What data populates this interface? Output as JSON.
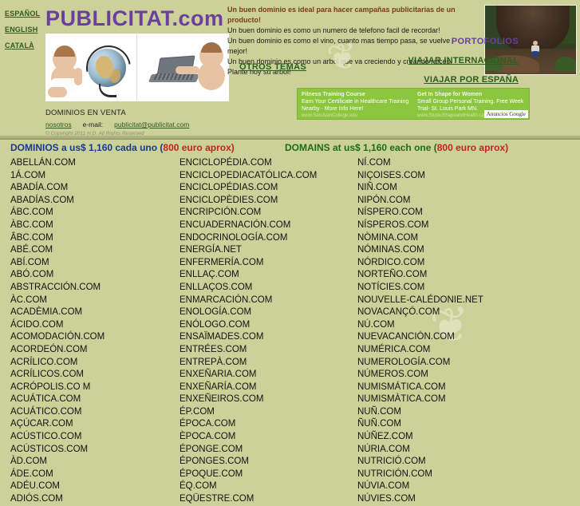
{
  "brand": "PUBLICITAT.com",
  "languages": [
    {
      "label": "ESPAÑOL"
    },
    {
      "label": "ENGLISH"
    },
    {
      "label": "CATALÀ"
    }
  ],
  "tagline": {
    "line1": "Un buen dominio es ideal para hacer campañas publicitarias de un producto!",
    "line2": "Un buen dominio es como un numero de telefono facil de recordar!",
    "line3": "Un buen dominio es como el vino, cuanto mas tiempo pasa, se vuelve mejor!",
    "line4": "Un buen dominio es como un arbol que va creciendo y creando raices. Plante hoy su arbol!"
  },
  "portfolio": {
    "title": "PORTOFOLIOS",
    "links": [
      {
        "label": "VIAJAR INTERNACIONAL"
      },
      {
        "label": "VIAJAR POR ESPAÑA"
      }
    ],
    "otros": "OTROS TEMAS"
  },
  "contact": {
    "heading": "DOMINIOS EN VENTA",
    "about_link": "nosotros",
    "email_label": "e-mail:",
    "email": "publicitat@publicitat.com",
    "copyright": "© Copyright 2011 H.D.  All Rights Reserved"
  },
  "ads": {
    "provider": "Anuncios Google",
    "items": [
      {
        "title": "Fitness Training Course",
        "text": "Earn Your Certificate in Healthcare Training Nearby - More Info Here!",
        "url": "www.SanJuanCollege.edu"
      },
      {
        "title": "Get In Shape for Women",
        "text": "Small Group Personal Training. Free Week Trial- St. Louis Park MN.",
        "url": "www.StudioShapeandHealth.com"
      }
    ]
  },
  "price_bar": {
    "es_prefix": "DOMINIOS a us$ 1,160 cada uno  (",
    "es_euro": "800 euro",
    "es_suffix": " aprox)",
    "en_prefix": "DOMAINS at us$ 1,160 each one (",
    "en_euro": "800 euro",
    "en_suffix": " aprox)"
  },
  "columns": {
    "col1": [
      "ABELLÁN.COM",
      "1Á.COM",
      "ABADÍA.COM",
      "ABADÍAS.COM",
      "ÁBC.COM",
      "ÀBC.COM",
      "ÂBC.COM",
      "ABÉ.COM",
      "ABÍ.COM",
      "ABÓ.COM",
      "ABSTRACCIÓN.COM",
      "ÀC.COM",
      "ACADÈMIA.COM",
      "ÁCIDO.COM",
      "ACOMODACIÓN.COM",
      "ACORDEÓN.COM",
      "ACRÍLICO.COM",
      "ACRÍLICOS.COM",
      "ACRÓPOLIS.CO M",
      "ACUÁTICA.COM",
      "ACUÁTICO.COM",
      "AÇÚCAR.COM",
      "ACÚSTICO.COM",
      "ACÚSTICOS.COM",
      "ÀD.COM",
      "ÁDE.COM",
      "ADÉU.COM",
      "ADIÓS.COM"
    ],
    "col2": [
      "ENCICLOPÉDIA.COM",
      "ENCICLOPEDIACATÓLICA.COM",
      "ENCICLOPÉDIAS.COM",
      "ENCICLOPÈDIES.COM",
      "ENCRIPCIÓN.COM",
      "ENCUADERNACIÓN.COM",
      "ENDOCRINOLOGÍA.COM",
      "ENERGÍA.NET",
      "ENFERMERÍA.COM",
      "ENLLAÇ.COM",
      "ENLLAÇOS.COM",
      "ENMARCACIÓN.COM",
      "ENOLOGÍA.COM",
      "ENÓLOGO.COM",
      "ENSAÏMADES.COM",
      "ENTRÉES.COM",
      "ENTREPÀ.COM",
      "ENXEÑARIA.COM",
      "ENXEÑARÍA.COM",
      "ENXEÑEIROS.COM",
      "ÉP.COM",
      "ÉPOCA.COM",
      "ÈPOCA.COM",
      "ÉPONGE.COM",
      "ÉPONGES.COM",
      "ÉPOQUE.COM",
      "ÉQ.COM",
      "EQÜESTRE.COM"
    ],
    "col3": [
      "NÍ.COM",
      "NIÇOISES.COM",
      "NIÑ.COM",
      "NIPÓN.COM",
      "NÍSPERO.COM",
      "NÍSPEROS.COM",
      "NÒMINA.COM",
      "NÓMINAS.COM",
      "NÓRDICO.COM",
      "NORTEÑO.COM",
      "NOTÍCIES.COM",
      "NOUVELLE-CALÉDONIE.NET",
      "NOVACANÇÓ.COM",
      "NÚ.COM",
      "NUEVACANCIÓN.COM",
      "NUMÉRICA.COM",
      "NUMEROLOGÍA.COM",
      "NÚMEROS.COM",
      "NUMISMÁTICA.COM",
      "NUMISMÀTICA.COM",
      "NUÑ.COM",
      "ÑUÑ.COM",
      "NÚÑEZ.COM",
      "NÚRIA.COM",
      "NUTRICIÓ.COM",
      "NUTRICIÓN.COM",
      "NÚVIA.COM",
      "NÚVIES.COM"
    ]
  },
  "colors": {
    "page_bg": "#ccd199",
    "brand_purple": "#6a3f9e",
    "link_green": "#2d5c1e",
    "price_blue": "#173a8c",
    "price_green": "#1d6b1d",
    "accent_red": "#c42026",
    "ad_green": "#8cc63f"
  }
}
